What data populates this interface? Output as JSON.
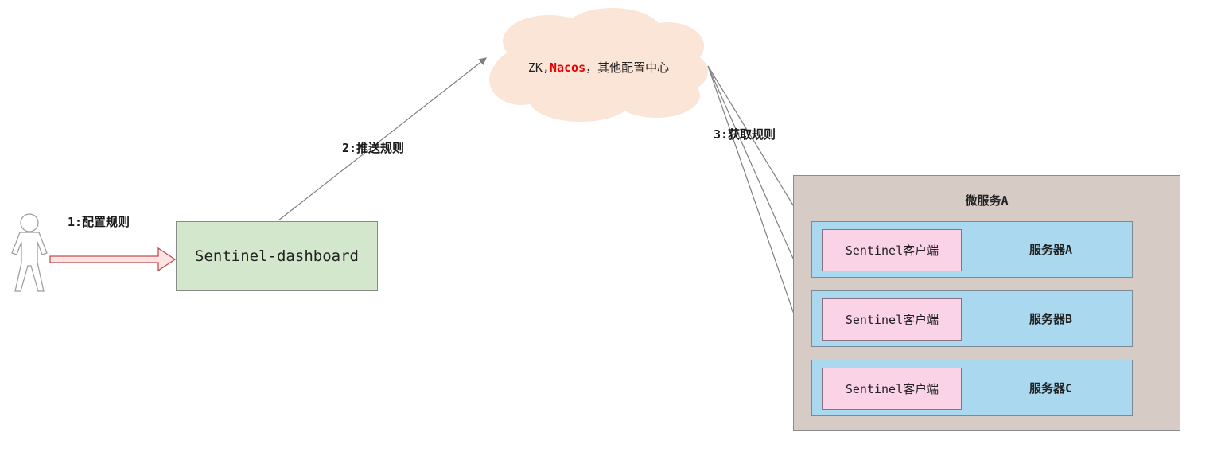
{
  "user": {
    "icon": "person-icon"
  },
  "steps": {
    "configure": "1:配置规则",
    "push": "2:推送规则",
    "fetch": "3:获取规则"
  },
  "dashboard": {
    "label": "Sentinel-dashboard"
  },
  "config_center": {
    "prefix": "ZK,",
    "nacos": "Nacos",
    "suffix": "，其他配置中心",
    "nacos_color": "#e60000"
  },
  "microservice": {
    "title": "微服务A",
    "servers": [
      {
        "client": "Sentinel客户端",
        "name": "服务器A"
      },
      {
        "client": "Sentinel客户端",
        "name": "服务器B"
      },
      {
        "client": "Sentinel客户端",
        "name": "服务器C"
      }
    ]
  },
  "colors": {
    "dashboard_fill": "#d3e7cc",
    "cloud_fill": "#fbe5d6",
    "microservice_fill": "#d6ccc5",
    "server_fill": "#a9d8ef",
    "client_fill": "#fbd3e6"
  }
}
